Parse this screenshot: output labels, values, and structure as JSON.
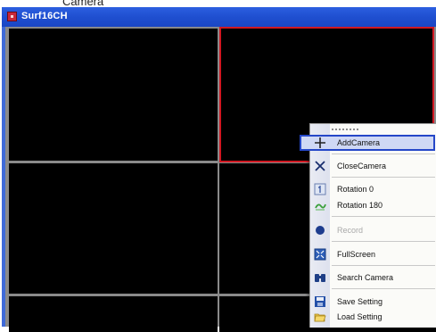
{
  "overlay_caption": "Camera",
  "window": {
    "title": "Surf16CH"
  },
  "context_menu": {
    "items": [
      {
        "label": "AddCamera",
        "icon": "plus-icon",
        "highlighted": true,
        "enabled": true
      },
      {
        "label": "CloseCamera",
        "icon": "close-x-icon",
        "enabled": true
      },
      {
        "label": "Rotation 0",
        "icon": "rotation-0-icon",
        "enabled": true
      },
      {
        "label": "Rotation 180",
        "icon": "rotation-180-icon",
        "enabled": true
      },
      {
        "label": "Record",
        "icon": "record-dot-icon",
        "enabled": false
      },
      {
        "label": "FullScreen",
        "icon": "fullscreen-icon",
        "enabled": true
      },
      {
        "label": "Search Camera",
        "icon": "binoculars-icon",
        "enabled": true
      },
      {
        "label": "Save Setting",
        "icon": "floppy-disk-icon",
        "enabled": true
      },
      {
        "label": "Load Setting",
        "icon": "folder-open-icon",
        "enabled": true
      }
    ]
  },
  "colors": {
    "selected_cell_border": "#d11822",
    "menu_highlight_border": "#2547c8",
    "title_bar": "#1f4fd0"
  }
}
